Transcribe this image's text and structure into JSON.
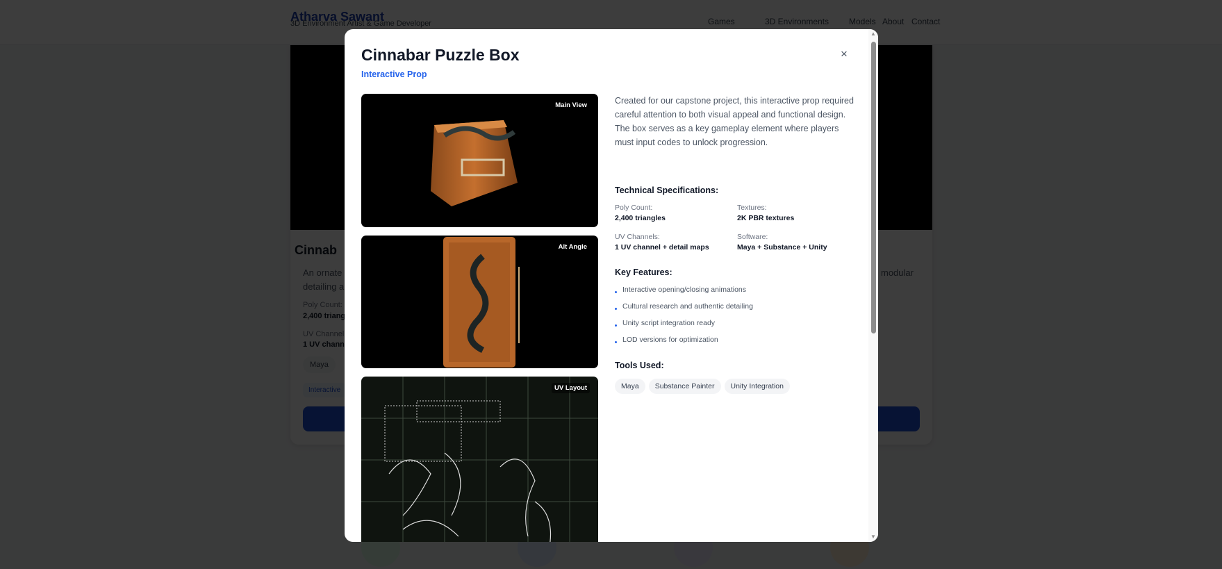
{
  "header": {
    "brand": "Atharva Sawant",
    "tagline": "3D Environment Artist & Game Developer",
    "nav": [
      "Games",
      "3D Environments",
      "Models",
      "About",
      "Contact"
    ]
  },
  "background_card": {
    "title": "Cinnab",
    "desc_line1": "An ornate",
    "desc_line2": "detailing a",
    "desc_right": "modular",
    "poly_label": "Poly Count:",
    "poly_value": "2,400 triang",
    "uv_label": "UV Channel",
    "uv_value": "1 UV channe",
    "tag": "Maya",
    "category": "Interactive"
  },
  "modal": {
    "title": "Cinnabar Puzzle Box",
    "subtitle": "Interactive Prop",
    "close": "×",
    "images": [
      {
        "label": "Main View"
      },
      {
        "label": "Alt Angle"
      },
      {
        "label": "UV Layout"
      }
    ],
    "description": "Created for our capstone project, this interactive prop required careful attention to both visual appeal and functional design. The box serves as a key gameplay element where players must input codes to unlock progression.",
    "specs_heading": "Technical Specifications:",
    "specs": [
      {
        "label": "Poly Count:",
        "value": "2,400 triangles"
      },
      {
        "label": "Textures:",
        "value": "2K PBR textures"
      },
      {
        "label": "UV Channels:",
        "value": "1 UV channel + detail maps"
      },
      {
        "label": "Software:",
        "value": "Maya + Substance + Unity"
      }
    ],
    "features_heading": "Key Features:",
    "features": [
      "Interactive opening/closing animations",
      "Cultural research and authentic detailing",
      "Unity script integration ready",
      "LOD versions for optimization"
    ],
    "tools_heading": "Tools Used:",
    "tools": [
      "Maya",
      "Substance Painter",
      "Unity Integration"
    ]
  },
  "colors": {
    "accent": "#2563eb",
    "overlay": "rgba(0,0,0,0.78)"
  },
  "scrollbar": {
    "position_fraction": 0.0
  }
}
